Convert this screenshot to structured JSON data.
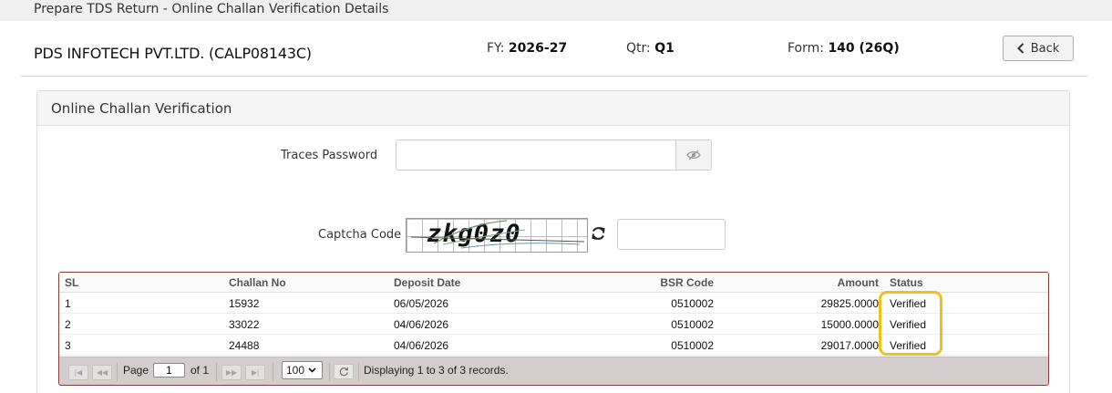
{
  "topbar": {
    "title": "Prepare TDS Return - Online Challan Verification Details"
  },
  "header": {
    "company": "PDS INFOTECH PVT.LTD. (CALP08143C)",
    "fy_label": "FY:",
    "fy_value": "2026-27",
    "qtr_label": "Qtr:",
    "qtr_value": "Q1",
    "form_label": "Form:",
    "form_value": "140 (26Q)",
    "back_label": "Back"
  },
  "panel": {
    "title": "Online Challan Verification",
    "traces_password_label": "Traces Password",
    "traces_password_value": "",
    "captcha_label": "Captcha Code",
    "captcha_text": "zkg0z0",
    "captcha_value": ""
  },
  "grid": {
    "columns": [
      "SL",
      "Challan No",
      "Deposit Date",
      "BSR Code",
      "Amount",
      "Status"
    ],
    "rows": [
      {
        "sl": "1",
        "challan_no": "15932",
        "deposit_date": "06/05/2026",
        "bsr_code": "0510002",
        "amount": "29825.0000",
        "status": "Verified"
      },
      {
        "sl": "2",
        "challan_no": "33022",
        "deposit_date": "04/06/2026",
        "bsr_code": "0510002",
        "amount": "15000.0000",
        "status": "Verified"
      },
      {
        "sl": "3",
        "challan_no": "24488",
        "deposit_date": "04/06/2026",
        "bsr_code": "0510002",
        "amount": "29017.0000",
        "status": "Verified"
      }
    ],
    "pager": {
      "page_label": "Page",
      "page_value": "1",
      "of_label": "of 1",
      "page_size": "100",
      "display_text": "Displaying 1 to 3 of 3 records."
    }
  },
  "colors": {
    "grid_border": "#8b3a3a",
    "highlight": "#f0c11a",
    "pager_bg": "#d3cdcd"
  },
  "icons": {
    "back": "chevron-left-icon",
    "eye": "eye-slash-icon",
    "refresh": "refresh-icon"
  }
}
